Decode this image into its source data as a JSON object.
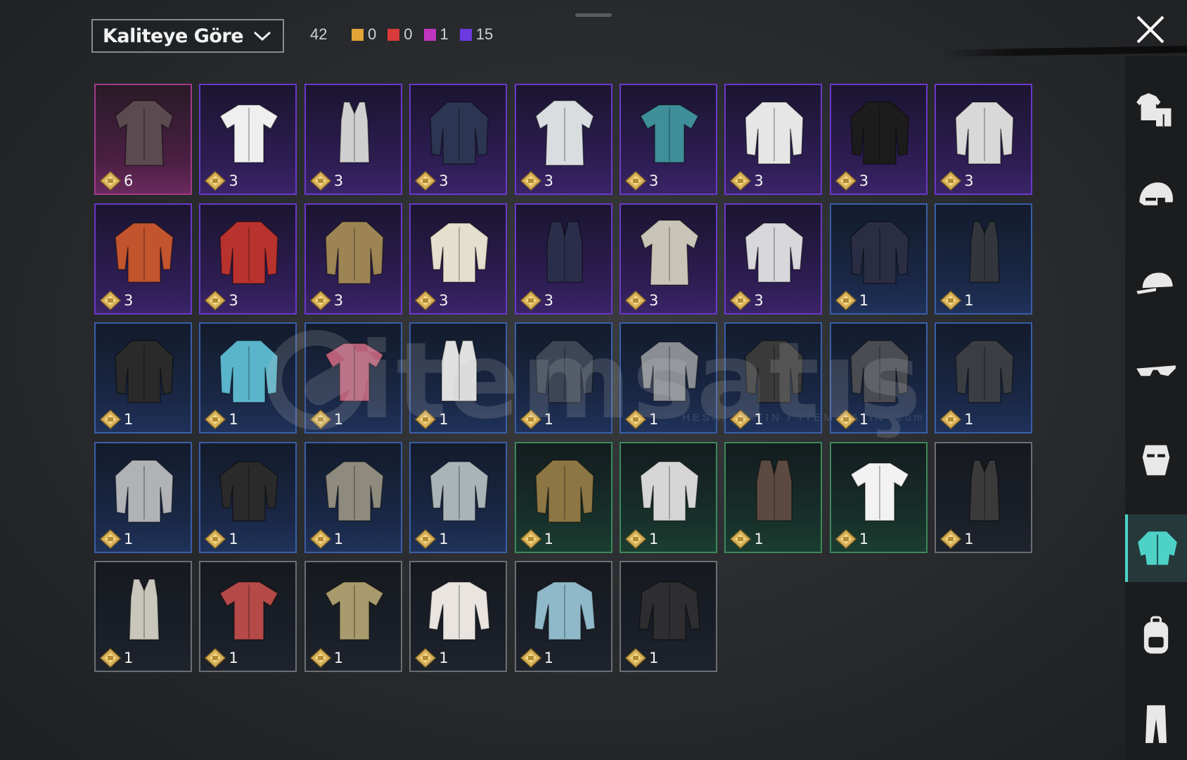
{
  "toolbar": {
    "sort_label": "Kaliteye Göre",
    "total": "42",
    "rarity_counts": [
      {
        "color": "#e3a336",
        "count": "0"
      },
      {
        "color": "#d93a3a",
        "count": "0"
      },
      {
        "color": "#c035c0",
        "count": "1"
      },
      {
        "color": "#6b3ae0",
        "count": "15"
      }
    ]
  },
  "watermark": {
    "brand": "itemsatış",
    "sub": "HESAP SATIN / ITEM SATIN .com"
  },
  "category_tabs": [
    {
      "name": "outfit-set",
      "icon": "outfit-set-icon",
      "active": false
    },
    {
      "name": "helmet",
      "icon": "helmet-icon",
      "active": false
    },
    {
      "name": "hat",
      "icon": "cap-icon",
      "active": false
    },
    {
      "name": "eyewear",
      "icon": "glasses-icon",
      "active": false
    },
    {
      "name": "mask",
      "icon": "mask-icon",
      "active": false
    },
    {
      "name": "tops",
      "icon": "shirt-icon",
      "active": true
    },
    {
      "name": "backpack",
      "icon": "backpack-icon",
      "active": false
    },
    {
      "name": "pants",
      "icon": "pants-icon",
      "active": false
    }
  ],
  "items": [
    {
      "rarity": "legendary",
      "qty": "6",
      "garment": "coat",
      "color": "#5b4a4f"
    },
    {
      "rarity": "epic",
      "qty": "3",
      "garment": "tshirt",
      "color": "#efefef"
    },
    {
      "rarity": "epic",
      "qty": "3",
      "garment": "tank",
      "color": "#cfcfcf"
    },
    {
      "rarity": "epic",
      "qty": "3",
      "garment": "jacket",
      "color": "#2c3552"
    },
    {
      "rarity": "epic",
      "qty": "3",
      "garment": "coat",
      "color": "#d9dde0"
    },
    {
      "rarity": "epic",
      "qty": "3",
      "garment": "tshirt",
      "color": "#3f8f9a"
    },
    {
      "rarity": "epic",
      "qty": "3",
      "garment": "jacket",
      "color": "#e6e6e6"
    },
    {
      "rarity": "epic",
      "qty": "3",
      "garment": "jacket",
      "color": "#1c1c1c"
    },
    {
      "rarity": "epic",
      "qty": "3",
      "garment": "jacket",
      "color": "#d8d8d8"
    },
    {
      "rarity": "epic",
      "qty": "3",
      "garment": "shirt",
      "color": "#c2542e"
    },
    {
      "rarity": "epic",
      "qty": "3",
      "garment": "jacket",
      "color": "#b8322e"
    },
    {
      "rarity": "epic",
      "qty": "3",
      "garment": "jacket",
      "color": "#9c8454"
    },
    {
      "rarity": "epic",
      "qty": "3",
      "garment": "shirt",
      "color": "#e4dfcf"
    },
    {
      "rarity": "epic",
      "qty": "3",
      "garment": "vest",
      "color": "#2a2e4a"
    },
    {
      "rarity": "epic",
      "qty": "3",
      "garment": "coat",
      "color": "#c9c4b8"
    },
    {
      "rarity": "epic",
      "qty": "3",
      "garment": "shirt",
      "color": "#d8d8dc"
    },
    {
      "rarity": "rare",
      "qty": "1",
      "garment": "jacket",
      "color": "#2a2d44"
    },
    {
      "rarity": "rare",
      "qty": "1",
      "garment": "tank",
      "color": "#33363c"
    },
    {
      "rarity": "rare",
      "qty": "1",
      "garment": "jacket",
      "color": "#2a2a2a"
    },
    {
      "rarity": "rare",
      "qty": "1",
      "garment": "jacket",
      "color": "#5ab4cc"
    },
    {
      "rarity": "rare",
      "qty": "1",
      "garment": "tshirt",
      "color": "#b8607a"
    },
    {
      "rarity": "rare",
      "qty": "1",
      "garment": "vest",
      "color": "#e0e0e0"
    },
    {
      "rarity": "rare",
      "qty": "1",
      "garment": "jacket",
      "color": "#3c4656"
    },
    {
      "rarity": "rare",
      "qty": "1",
      "garment": "shirt",
      "color": "#8a8e94"
    },
    {
      "rarity": "rare",
      "qty": "1",
      "garment": "jacket",
      "color": "#3a3a3a"
    },
    {
      "rarity": "rare",
      "qty": "1",
      "garment": "jacket",
      "color": "#4a4c52"
    },
    {
      "rarity": "rare",
      "qty": "1",
      "garment": "jacket",
      "color": "#3a3d42"
    },
    {
      "rarity": "rare",
      "qty": "1",
      "garment": "jacket",
      "color": "#b0b2b6"
    },
    {
      "rarity": "rare",
      "qty": "1",
      "garment": "shirt",
      "color": "#2a2a2a"
    },
    {
      "rarity": "rare",
      "qty": "1",
      "garment": "shirt",
      "color": "#8e8a7e"
    },
    {
      "rarity": "rare",
      "qty": "1",
      "garment": "shirt",
      "color": "#a9b3b8"
    },
    {
      "rarity": "uncommon",
      "qty": "1",
      "garment": "jacket",
      "color": "#8c7644"
    },
    {
      "rarity": "uncommon",
      "qty": "1",
      "garment": "shirt",
      "color": "#d6d6d6"
    },
    {
      "rarity": "uncommon",
      "qty": "1",
      "garment": "vest",
      "color": "#5c4a40"
    },
    {
      "rarity": "uncommon",
      "qty": "1",
      "garment": "tshirt",
      "color": "#f2f2f2"
    },
    {
      "rarity": "common",
      "qty": "1",
      "garment": "tank",
      "color": "#3a3a3a"
    },
    {
      "rarity": "common",
      "qty": "1",
      "garment": "tank",
      "color": "#c9c6bc"
    },
    {
      "rarity": "common",
      "qty": "1",
      "garment": "tshirt",
      "color": "#b54a48"
    },
    {
      "rarity": "common",
      "qty": "1",
      "garment": "tshirt",
      "color": "#a89a6c"
    },
    {
      "rarity": "common",
      "qty": "1",
      "garment": "longsleeve",
      "color": "#e9e4e0"
    },
    {
      "rarity": "common",
      "qty": "1",
      "garment": "longsleeve",
      "color": "#8fb8c8"
    },
    {
      "rarity": "common",
      "qty": "1",
      "garment": "longsleeve",
      "color": "#2e2e30"
    }
  ]
}
